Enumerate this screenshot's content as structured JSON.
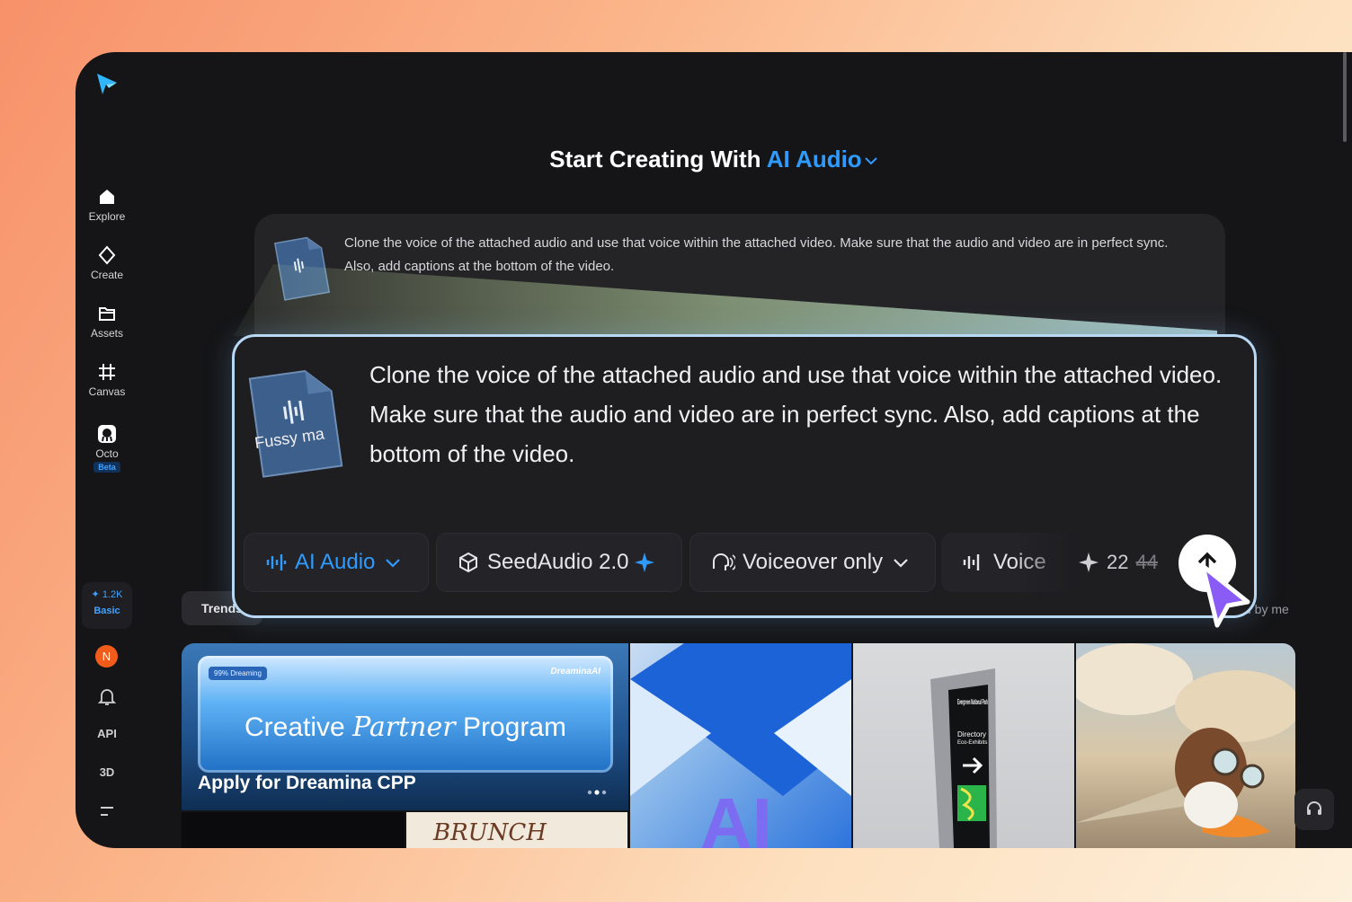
{
  "app": {
    "brand": "Dreamina AI"
  },
  "sidebar": {
    "items": [
      {
        "label": "Explore",
        "icon": "home-icon"
      },
      {
        "label": "Create",
        "icon": "sparkle-icon"
      },
      {
        "label": "Assets",
        "icon": "folder-icon"
      },
      {
        "label": "Canvas",
        "icon": "canvas-icon"
      },
      {
        "label": "Octo",
        "icon": "octo-icon",
        "badge": "Beta"
      }
    ],
    "credits": {
      "amount": "1.2K",
      "plan": "Basic"
    },
    "avatar_initial": "N",
    "api_label": "API",
    "three_d_label": "3D"
  },
  "header": {
    "title_prefix": "Start Creating With",
    "title_accent": "AI Audio"
  },
  "prompt": {
    "text": "Clone the voice of the attached audio and use that voice within the attached video. Make sure that the audio and video are in perfect sync. Also, add captions at the bottom of the video.",
    "attachment_label": "Fussy ma"
  },
  "toolbar": {
    "mode": "AI Audio",
    "model": "SeedAudio 2.0",
    "voice_option": "Voiceover only",
    "voice_chip": "Voice",
    "cost": "22",
    "cost_original": "44"
  },
  "tabs": {
    "trends": "Trends",
    "liked": "d by me"
  },
  "gallery": {
    "cpp_tag": "99% Dreaming",
    "cpp_brand": "DreaminaAI",
    "cpp_title_a": "Creative",
    "cpp_title_b": "Partner",
    "cpp_title_c": "Program",
    "cpp_caption": "Apply for Dreamina CPP",
    "brunch": "BRUNCH SPECIALS",
    "ai_letters": "AI",
    "sign_title": "Evergreen National Park",
    "sign_sub": "Directory",
    "sign_sub2": "Eco-Exhibits"
  },
  "colors": {
    "accent": "#2f9bff",
    "background": "#151517",
    "card": "#242427"
  }
}
